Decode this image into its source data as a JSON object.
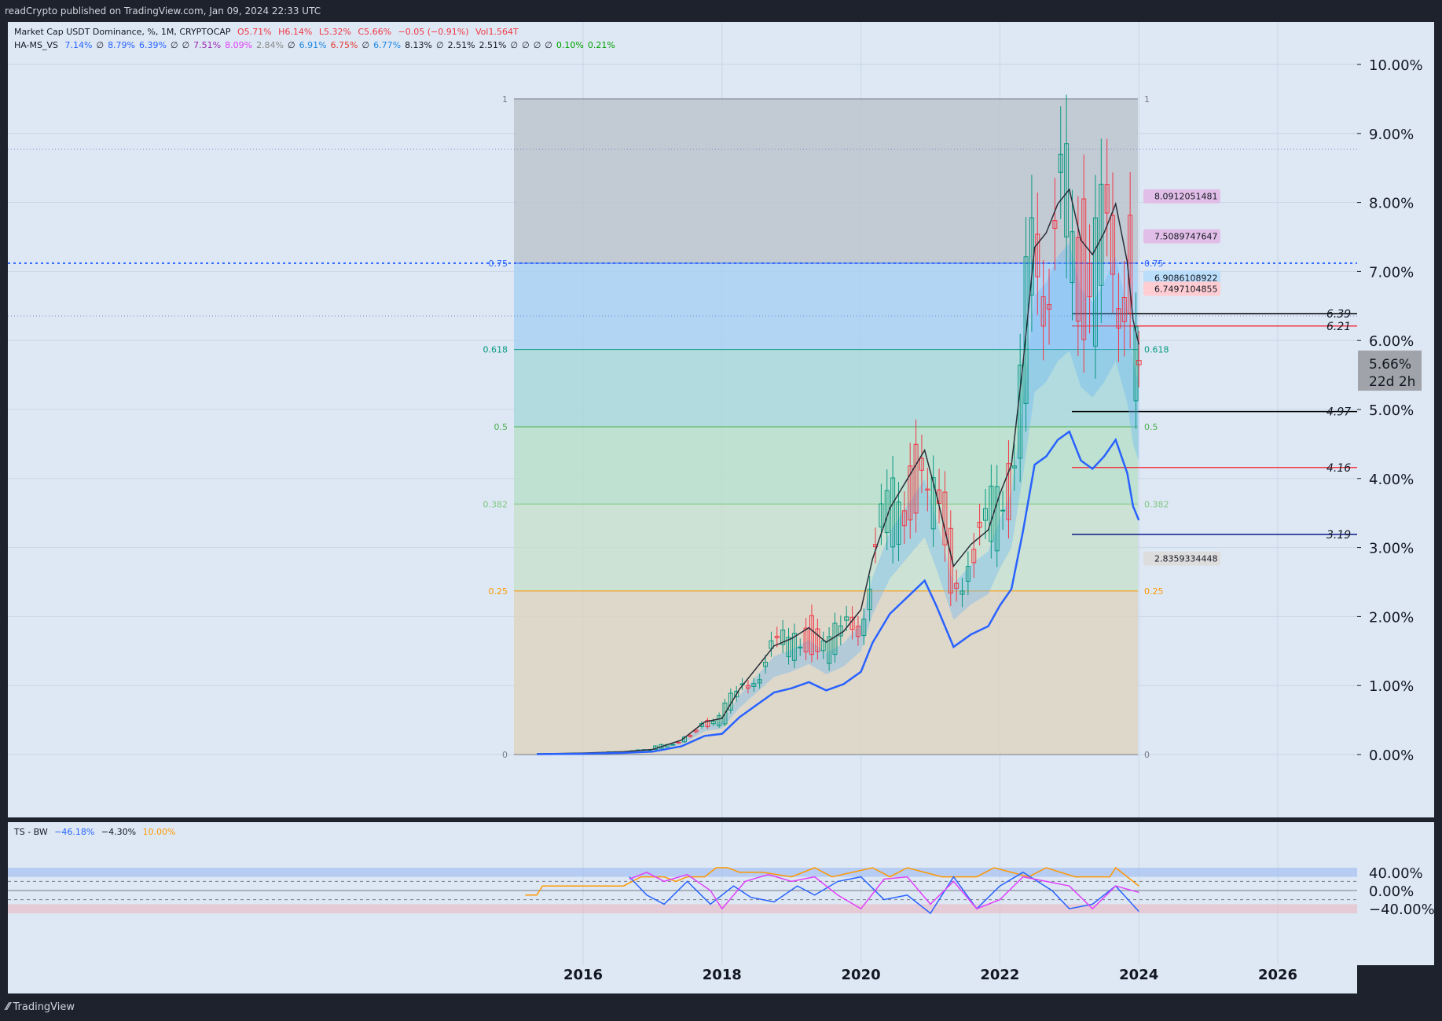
{
  "header": {
    "published": "readCrypto published on TradingView.com, Jan 09, 2024 22:33 UTC"
  },
  "footer": {
    "brand": "TradingView"
  },
  "legend_main": {
    "symbol": "Market Cap USDT Dominance, %, 1M, CRYPTOCAP",
    "open": "O5.71%",
    "high": "H6.14%",
    "low": "L5.32%",
    "close": "C5.66%",
    "change": "−0.05 (−0.91%)",
    "vol": "Vol1.564T"
  },
  "legend_ind": {
    "name": "HA-MS_VS",
    "items": [
      {
        "t": "7.14%",
        "c": "#2962ff"
      },
      {
        "t": "∅",
        "c": "#131722"
      },
      {
        "t": "8.79%",
        "c": "#2962ff"
      },
      {
        "t": "6.39%",
        "c": "#2962ff"
      },
      {
        "t": "∅",
        "c": "#131722"
      },
      {
        "t": "∅",
        "c": "#131722"
      },
      {
        "t": "7.51%",
        "c": "#9c27b0"
      },
      {
        "t": "8.09%",
        "c": "#e040fb"
      },
      {
        "t": "2.84%",
        "c": "#888888"
      },
      {
        "t": "∅",
        "c": "#131722"
      },
      {
        "t": "6.91%",
        "c": "#1e88e5"
      },
      {
        "t": "6.75%",
        "c": "#e53935"
      },
      {
        "t": "∅",
        "c": "#131722"
      },
      {
        "t": "6.77%",
        "c": "#1e88e5"
      },
      {
        "t": "8.13%",
        "c": "#131722"
      },
      {
        "t": "∅",
        "c": "#131722"
      },
      {
        "t": "2.51%",
        "c": "#131722"
      },
      {
        "t": "2.51%",
        "c": "#131722"
      },
      {
        "t": "∅",
        "c": "#131722"
      },
      {
        "t": "∅",
        "c": "#131722"
      },
      {
        "t": "∅",
        "c": "#131722"
      },
      {
        "t": "∅",
        "c": "#131722"
      },
      {
        "t": "0.10%",
        "c": "#00a000"
      },
      {
        "t": "0.21%",
        "c": "#00a000"
      }
    ]
  },
  "legend_osc": {
    "name": "TS - BW",
    "v1": "−46.18%",
    "v2": "−4.30%",
    "v3": "10.00%"
  },
  "price_box": {
    "value": "5.66%",
    "countdown": "22d 2h"
  },
  "colors": {
    "background": "#dde8f4",
    "frame": "#1e222d",
    "up": "#089981",
    "down": "#f23645"
  },
  "chart_data": [
    {
      "type": "candlestick",
      "title": "Market Cap USDT Dominance, %, 1M, CRYPTOCAP",
      "x_ticks": [
        "2016",
        "2018",
        "2020",
        "2022",
        "2024",
        "2026"
      ],
      "y_ticks": [
        "0.00%",
        "1.00%",
        "2.00%",
        "3.00%",
        "4.00%",
        "5.00%",
        "6.00%",
        "7.00%",
        "8.00%",
        "9.00%",
        "10.00%"
      ],
      "ylim": [
        0,
        10.5
      ],
      "fib_levels": [
        {
          "label": "1",
          "value": 9.5
        },
        {
          "label": "0.75",
          "value": 7.12
        },
        {
          "label": "0.618",
          "value": 5.87
        },
        {
          "label": "0.5",
          "value": 4.75
        },
        {
          "label": "0.382",
          "value": 3.63
        },
        {
          "label": "0.25",
          "value": 2.37
        },
        {
          "label": "0",
          "value": 0
        }
      ],
      "right_levels": [
        {
          "label": "6.39",
          "value": 6.39,
          "color": "#000000"
        },
        {
          "label": "6.21",
          "value": 6.21,
          "color": "#f23645"
        },
        {
          "label": "4.97",
          "value": 4.97,
          "color": "#000000"
        },
        {
          "label": "4.16",
          "value": 4.16,
          "color": "#f23645"
        },
        {
          "label": "3.19",
          "value": 3.19,
          "color": "#0d1b8c"
        }
      ],
      "tags": [
        {
          "label": "8.0912051481",
          "value": 8.09,
          "bg": "#e1bee7"
        },
        {
          "label": "7.5089747647",
          "value": 7.51,
          "bg": "#e1bee7"
        },
        {
          "label": "6.9086108922",
          "value": 6.91,
          "bg": "#bbdefb"
        },
        {
          "label": "6.7497104855",
          "value": 6.75,
          "bg": "#ffcdd2"
        },
        {
          "label": "2.8359334448",
          "value": 2.84,
          "bg": "#dddddd"
        }
      ],
      "ohlc_anchor": {
        "date": "2024-01",
        "open": 5.71,
        "high": 6.14,
        "low": 5.32,
        "close": 5.66
      },
      "trend_points": [
        [
          "2015-05",
          0.01
        ],
        [
          "2016-01",
          0.02
        ],
        [
          "2016-08",
          0.04
        ],
        [
          "2017-01",
          0.07
        ],
        [
          "2017-06",
          0.2
        ],
        [
          "2017-10",
          0.45
        ],
        [
          "2018-01",
          0.5
        ],
        [
          "2018-04",
          0.9
        ],
        [
          "2018-07",
          1.2
        ],
        [
          "2018-10",
          1.5
        ],
        [
          "2019-01",
          1.6
        ],
        [
          "2019-04",
          1.75
        ],
        [
          "2019-07",
          1.55
        ],
        [
          "2019-10",
          1.7
        ],
        [
          "2020-01",
          2.0
        ],
        [
          "2020-03",
          2.7
        ],
        [
          "2020-06",
          3.4
        ],
        [
          "2020-09",
          3.8
        ],
        [
          "2020-12",
          4.2
        ],
        [
          "2021-02",
          3.6
        ],
        [
          "2021-05",
          2.6
        ],
        [
          "2021-08",
          2.9
        ],
        [
          "2021-11",
          3.1
        ],
        [
          "2022-01",
          3.6
        ],
        [
          "2022-03",
          4.0
        ],
        [
          "2022-05",
          5.4
        ],
        [
          "2022-07",
          7.0
        ],
        [
          "2022-09",
          7.2
        ],
        [
          "2022-11",
          7.6
        ],
        [
          "2023-01",
          7.8
        ],
        [
          "2023-03",
          7.1
        ],
        [
          "2023-05",
          6.9
        ],
        [
          "2023-07",
          7.2
        ],
        [
          "2023-09",
          7.6
        ],
        [
          "2023-11",
          6.8
        ],
        [
          "2023-12",
          6.0
        ],
        [
          "2024-01",
          5.66
        ]
      ]
    },
    {
      "type": "line",
      "title": "TS - BW",
      "y_ticks": [
        "40.00%",
        "0.00%",
        "−40.00%"
      ],
      "ylim": [
        -50,
        50
      ],
      "series": [
        {
          "name": "",
          "color": "#ff9800",
          "values": [
            [
              "2015-03",
              -10
            ],
            [
              "2015-05",
              -10
            ],
            [
              "2015-06",
              10
            ],
            [
              "2016-08",
              10
            ],
            [
              "2016-11",
              30
            ],
            [
              "2017-03",
              30
            ],
            [
              "2017-05",
              20
            ],
            [
              "2017-07",
              30
            ],
            [
              "2017-10",
              30
            ],
            [
              "2017-12",
              50
            ],
            [
              "2018-02",
              50
            ],
            [
              "2018-04",
              40
            ],
            [
              "2018-08",
              40
            ],
            [
              "2019-01",
              30
            ],
            [
              "2019-05",
              50
            ],
            [
              "2019-08",
              30
            ],
            [
              "2020-03",
              50
            ],
            [
              "2020-06",
              30
            ],
            [
              "2020-09",
              50
            ],
            [
              "2021-03",
              30
            ],
            [
              "2021-09",
              30
            ],
            [
              "2021-12",
              50
            ],
            [
              "2022-06",
              30
            ],
            [
              "2022-09",
              50
            ],
            [
              "2023-02",
              30
            ],
            [
              "2023-08",
              30
            ],
            [
              "2023-09",
              50
            ],
            [
              "2023-11",
              30
            ],
            [
              "2024-01",
              10
            ]
          ]
        },
        {
          "name": "",
          "color": "#2962ff",
          "values": [
            [
              "2016-09",
              30
            ],
            [
              "2016-12",
              -10
            ],
            [
              "2017-03",
              -30
            ],
            [
              "2017-07",
              20
            ],
            [
              "2017-11",
              -30
            ],
            [
              "2018-03",
              10
            ],
            [
              "2018-06",
              -15
            ],
            [
              "2018-10",
              -25
            ],
            [
              "2019-02",
              10
            ],
            [
              "2019-05",
              -10
            ],
            [
              "2019-09",
              20
            ],
            [
              "2020-01",
              30
            ],
            [
              "2020-05",
              -20
            ],
            [
              "2020-09",
              -10
            ],
            [
              "2021-01",
              -50
            ],
            [
              "2021-05",
              30
            ],
            [
              "2021-09",
              -40
            ],
            [
              "2022-01",
              10
            ],
            [
              "2022-05",
              40
            ],
            [
              "2022-10",
              0
            ],
            [
              "2023-01",
              -40
            ],
            [
              "2023-05",
              -30
            ],
            [
              "2023-09",
              10
            ],
            [
              "2024-01",
              -46
            ]
          ]
        },
        {
          "name": "",
          "color": "#e040fb",
          "values": [
            [
              "2016-09",
              25
            ],
            [
              "2016-12",
              40
            ],
            [
              "2017-03",
              20
            ],
            [
              "2017-07",
              35
            ],
            [
              "2017-11",
              0
            ],
            [
              "2018-01",
              -40
            ],
            [
              "2018-05",
              20
            ],
            [
              "2018-09",
              35
            ],
            [
              "2019-01",
              20
            ],
            [
              "2019-05",
              30
            ],
            [
              "2019-09",
              -10
            ],
            [
              "2020-01",
              -40
            ],
            [
              "2020-05",
              25
            ],
            [
              "2020-09",
              30
            ],
            [
              "2021-01",
              -30
            ],
            [
              "2021-05",
              20
            ],
            [
              "2021-09",
              -40
            ],
            [
              "2022-01",
              -20
            ],
            [
              "2022-05",
              30
            ],
            [
              "2022-09",
              20
            ],
            [
              "2023-01",
              10
            ],
            [
              "2023-05",
              -40
            ],
            [
              "2023-09",
              10
            ],
            [
              "2024-01",
              -4
            ]
          ]
        }
      ]
    }
  ]
}
